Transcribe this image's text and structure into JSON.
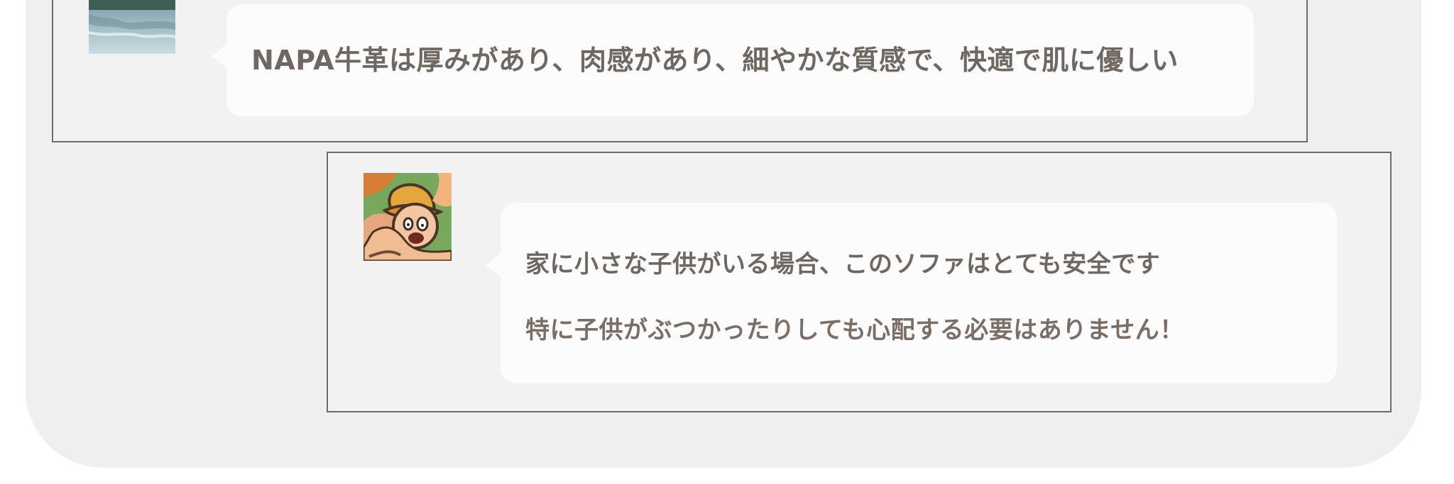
{
  "reviews": [
    {
      "avatar_icon": "lake-landscape-avatar",
      "lines": [
        "NAPA牛革は厚みがあり、肉感があり、細やかな質感で、快適で肌に優しい"
      ]
    },
    {
      "avatar_icon": "cartoon-character-avatar",
      "lines": [
        "家に小さな子供がいる場合、このソファはとても安全です",
        "特に子供がぶつかったりしても心配する必要はありません！"
      ]
    }
  ],
  "colors": {
    "panel_background": "#efefef",
    "card_background": "#f2f2f2",
    "card_border": "#6c6c6c",
    "bubble_background": "#fcfcfc",
    "text": "#6f6762"
  }
}
